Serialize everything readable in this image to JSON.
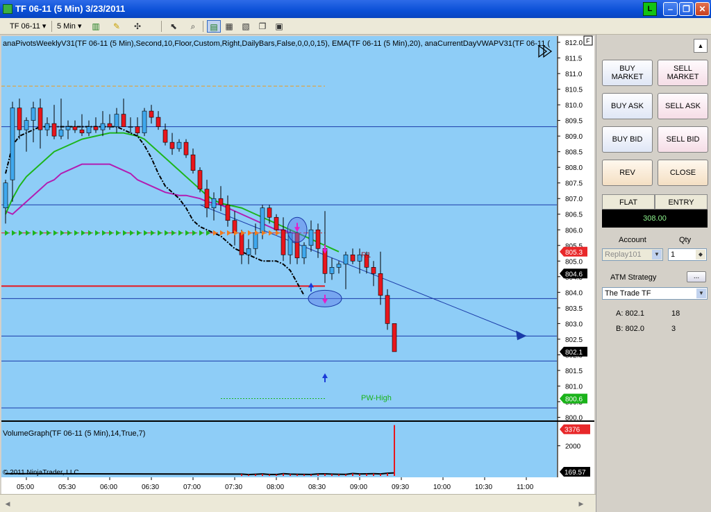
{
  "window": {
    "title": "TF 06-11 (5 Min)  3/23/2011",
    "status_letter": "L",
    "min_glyph": "‒",
    "restore_glyph": "❐",
    "close_glyph": "✕"
  },
  "toolbar": {
    "instrument": "TF 06-11",
    "interval": "5 Min",
    "dropdown_glyph": "▾"
  },
  "chart": {
    "indicator_label": "anaPivotsWeeklyV31(TF 06-11 (5 Min),Second,10,Floor,Custom,Right,DailyBars,False,0,0,0,15), EMA(TF 06-11 (5 Min),20), anaCurrentDayVWAPV31(TF 06-11 (",
    "f_button": "F",
    "annotations": {
      "r1": "R1",
      "pw_high": "PW-High"
    },
    "price_axis": [
      "812.0",
      "811.5",
      "811.0",
      "810.5",
      "810.0",
      "809.5",
      "809.0",
      "808.5",
      "808.0",
      "807.5",
      "807.0",
      "806.5",
      "806.0",
      "805.5",
      "805.0",
      "804.5",
      "804.0",
      "803.5",
      "803.0",
      "802.5",
      "802.0",
      "801.5",
      "801.0",
      "800.5",
      "800.0"
    ],
    "price_badges": [
      {
        "label": "805.3",
        "value": 805.3,
        "color": "#e8282a"
      },
      {
        "label": "804.6",
        "value": 804.6,
        "color": "#000000"
      },
      {
        "label": "802.1",
        "value": 802.1,
        "color": "#000000"
      },
      {
        "label": "800.6",
        "value": 800.6,
        "color": "#1ab31a"
      }
    ],
    "time_axis": [
      "05:00",
      "05:30",
      "06:00",
      "06:30",
      "07:00",
      "07:30",
      "08:00",
      "08:30",
      "09:00",
      "09:30",
      "10:00",
      "10:30",
      "11:00"
    ],
    "volume_label": "VolumeGraph(TF 06-11 (5 Min),14,True,7)",
    "volume_axis": [
      "2000"
    ],
    "volume_badges": [
      {
        "label": "3376",
        "value": 3376,
        "color": "#e8282a"
      },
      {
        "label": "169.57",
        "value": 169.57,
        "color": "#000000"
      }
    ],
    "copyright": "© 2011 NinjaTrader, LLC",
    "colors": {
      "background": "#8ecdf7",
      "up": "#3fa8ee",
      "down": "#e8161c",
      "ema": "#1db51d",
      "vwap": "#b21db2",
      "fast_ma": "#000000",
      "hlines": "#1a3aa8",
      "pivot_orange": "#f09b1c"
    }
  },
  "chart_data": {
    "type": "candlestick",
    "title": "TF 06-11 (5 Min)  3/23/2011",
    "y_range": [
      799.9,
      812.2
    ],
    "time_start": "04:45",
    "bar_minutes": 5,
    "candles": [
      {
        "o": 806.7,
        "h": 807.6,
        "l": 806.2,
        "c": 807.5
      },
      {
        "o": 807.6,
        "h": 810.1,
        "l": 806.9,
        "c": 809.9
      },
      {
        "o": 809.9,
        "h": 810.2,
        "l": 808.9,
        "c": 809.2
      },
      {
        "o": 809.2,
        "h": 809.6,
        "l": 808.5,
        "c": 809.5
      },
      {
        "o": 809.5,
        "h": 810.1,
        "l": 808.8,
        "c": 809.9
      },
      {
        "o": 809.9,
        "h": 810.2,
        "l": 808.6,
        "c": 809.2
      },
      {
        "o": 809.2,
        "h": 809.6,
        "l": 809.0,
        "c": 809.4
      },
      {
        "o": 809.4,
        "h": 810.0,
        "l": 808.9,
        "c": 809.0
      },
      {
        "o": 809.0,
        "h": 810.2,
        "l": 808.9,
        "c": 809.2
      },
      {
        "o": 809.2,
        "h": 809.5,
        "l": 808.9,
        "c": 809.3
      },
      {
        "o": 809.3,
        "h": 809.5,
        "l": 809.1,
        "c": 809.2
      },
      {
        "o": 809.2,
        "h": 809.7,
        "l": 809.0,
        "c": 809.1
      },
      {
        "o": 809.1,
        "h": 809.5,
        "l": 809.0,
        "c": 809.3
      },
      {
        "o": 809.3,
        "h": 809.6,
        "l": 809.1,
        "c": 809.2
      },
      {
        "o": 809.2,
        "h": 809.8,
        "l": 809.0,
        "c": 809.4
      },
      {
        "o": 809.4,
        "h": 809.7,
        "l": 809.2,
        "c": 809.3
      },
      {
        "o": 809.3,
        "h": 809.9,
        "l": 809.1,
        "c": 809.7
      },
      {
        "o": 809.7,
        "h": 810.2,
        "l": 809.3,
        "c": 809.3
      },
      {
        "o": 809.3,
        "h": 809.6,
        "l": 809.1,
        "c": 809.3
      },
      {
        "o": 809.3,
        "h": 809.6,
        "l": 809.0,
        "c": 809.1
      },
      {
        "o": 809.1,
        "h": 809.9,
        "l": 809.0,
        "c": 809.8
      },
      {
        "o": 809.8,
        "h": 810.0,
        "l": 809.4,
        "c": 809.6
      },
      {
        "o": 809.6,
        "h": 809.8,
        "l": 809.2,
        "c": 809.3
      },
      {
        "o": 809.2,
        "h": 809.4,
        "l": 808.7,
        "c": 808.8
      },
      {
        "o": 808.8,
        "h": 809.1,
        "l": 808.4,
        "c": 808.6
      },
      {
        "o": 808.6,
        "h": 808.9,
        "l": 808.5,
        "c": 808.8
      },
      {
        "o": 808.8,
        "h": 808.9,
        "l": 808.3,
        "c": 808.4
      },
      {
        "o": 808.4,
        "h": 808.6,
        "l": 807.8,
        "c": 807.9
      },
      {
        "o": 807.9,
        "h": 808.0,
        "l": 807.2,
        "c": 807.3
      },
      {
        "o": 807.3,
        "h": 807.6,
        "l": 806.4,
        "c": 806.7
      },
      {
        "o": 806.7,
        "h": 807.2,
        "l": 806.3,
        "c": 807.0
      },
      {
        "o": 807.0,
        "h": 807.4,
        "l": 806.6,
        "c": 806.8
      },
      {
        "o": 806.8,
        "h": 807.1,
        "l": 806.1,
        "c": 806.3
      },
      {
        "o": 806.3,
        "h": 806.6,
        "l": 805.5,
        "c": 805.9
      },
      {
        "o": 805.9,
        "h": 806.0,
        "l": 804.9,
        "c": 805.2
      },
      {
        "o": 805.2,
        "h": 805.7,
        "l": 804.9,
        "c": 805.4
      },
      {
        "o": 805.4,
        "h": 806.2,
        "l": 805.2,
        "c": 805.9
      },
      {
        "o": 805.9,
        "h": 806.8,
        "l": 805.7,
        "c": 806.7
      },
      {
        "o": 806.7,
        "h": 806.8,
        "l": 806.2,
        "c": 806.4
      },
      {
        "o": 806.4,
        "h": 806.5,
        "l": 805.9,
        "c": 806.0
      },
      {
        "o": 806.0,
        "h": 806.4,
        "l": 805.0,
        "c": 805.2
      },
      {
        "o": 805.2,
        "h": 806.0,
        "l": 804.9,
        "c": 805.9
      },
      {
        "o": 805.9,
        "h": 806.2,
        "l": 804.9,
        "c": 805.1
      },
      {
        "o": 805.1,
        "h": 805.6,
        "l": 804.9,
        "c": 805.5
      },
      {
        "o": 805.5,
        "h": 806.3,
        "l": 805.3,
        "c": 806.0
      },
      {
        "o": 806.0,
        "h": 806.2,
        "l": 805.1,
        "c": 805.4
      },
      {
        "o": 805.4,
        "h": 806.6,
        "l": 804.3,
        "c": 804.6
      },
      {
        "o": 804.6,
        "h": 805.1,
        "l": 804.4,
        "c": 804.8
      },
      {
        "o": 804.8,
        "h": 805.0,
        "l": 804.6,
        "c": 804.9
      },
      {
        "o": 804.9,
        "h": 805.3,
        "l": 804.1,
        "c": 805.2
      },
      {
        "o": 805.2,
        "h": 805.4,
        "l": 804.9,
        "c": 805.0
      },
      {
        "o": 805.0,
        "h": 805.4,
        "l": 804.6,
        "c": 805.2
      },
      {
        "o": 805.2,
        "h": 805.3,
        "l": 804.6,
        "c": 804.8
      },
      {
        "o": 804.8,
        "h": 805.0,
        "l": 804.2,
        "c": 804.6
      },
      {
        "o": 804.6,
        "h": 805.3,
        "l": 803.6,
        "c": 803.9
      },
      {
        "o": 803.9,
        "h": 804.1,
        "l": 802.8,
        "c": 803.0
      },
      {
        "o": 803.0,
        "h": 803.0,
        "l": 802.1,
        "c": 802.1
      }
    ],
    "volume": [
      120,
      90,
      110,
      130,
      100,
      95,
      150,
      120,
      110,
      105,
      100,
      130,
      140,
      120,
      110,
      105,
      160,
      130,
      140,
      150,
      135,
      180,
      3376
    ],
    "volume_range": [
      0,
      3500
    ],
    "horizontal_levels": [
      {
        "value": 810.6,
        "color": "#f09b1c",
        "style": "dashed",
        "x_end_time": "08:35"
      },
      {
        "value": 809.3,
        "color": "#1a3aa8",
        "style": "solid"
      },
      {
        "value": 806.8,
        "color": "#1a3aa8",
        "style": "solid"
      },
      {
        "value": 805.9,
        "color": "#e8161c",
        "style": "dashdot",
        "x_end_time": "08:35"
      },
      {
        "value": 804.2,
        "color": "#e8161c",
        "style": "solid",
        "x_end_time": "08:35"
      },
      {
        "value": 803.8,
        "color": "#1a3aa8",
        "style": "solid"
      },
      {
        "value": 802.6,
        "color": "#1a3aa8",
        "style": "solid"
      },
      {
        "value": 801.8,
        "color": "#1a3aa8",
        "style": "solid"
      },
      {
        "value": 800.6,
        "color": "#1ab31a",
        "style": "dotted",
        "x_start_time": "07:20",
        "x_end_time": "08:35"
      },
      {
        "value": 800.3,
        "color": "#1a3aa8",
        "style": "solid"
      }
    ],
    "trendline": {
      "from": {
        "time": "07:05",
        "price": 806.8
      },
      "to": {
        "time": "11:00",
        "price": 802.6
      },
      "color": "#1a3aa8"
    },
    "ema": [
      806.5,
      807.0,
      807.4,
      807.7,
      807.9,
      808.1,
      808.3,
      808.5,
      808.6,
      808.7,
      808.8,
      808.9,
      808.95,
      809.0,
      809.05,
      809.1,
      809.1,
      809.1,
      809.05,
      809.0,
      808.9,
      808.7,
      808.5,
      808.3,
      808.1,
      807.9,
      807.7,
      807.5,
      807.3,
      807.1,
      806.95,
      806.85,
      806.8,
      806.75,
      806.7,
      806.6,
      806.5,
      806.4,
      806.3,
      806.2,
      806.1,
      806.0,
      805.9,
      805.8,
      805.7,
      805.6,
      805.5,
      805.4,
      805.3
    ],
    "vwap": [
      806.6,
      806.5,
      806.7,
      806.9,
      807.1,
      807.3,
      807.5,
      807.6,
      807.8,
      807.9,
      808.0,
      808.1,
      808.1,
      808.1,
      808.1,
      808.1,
      808.0,
      807.9,
      807.8,
      807.6,
      807.5,
      807.4,
      807.3,
      807.2,
      807.15,
      807.1,
      807.1,
      807.05,
      807.0,
      806.9,
      806.85,
      806.8,
      806.7,
      806.6,
      806.5,
      806.4,
      806.3,
      806.2,
      806.1,
      806.0,
      806.0,
      805.9,
      805.9
    ],
    "fast_ma": [
      807.8,
      808.7,
      809.0,
      809.1,
      809.2,
      809.3,
      809.3,
      809.3,
      809.3,
      809.3,
      809.3,
      809.3,
      809.3,
      809.3,
      809.3,
      809.3,
      809.3,
      809.2,
      809.1,
      809.0,
      808.7,
      808.3,
      807.8,
      807.4,
      807.2,
      807.0,
      806.7,
      806.3,
      806.1,
      806.0,
      805.9,
      805.8,
      805.6,
      805.4,
      805.3,
      805.2,
      805.1,
      805.0,
      805.0,
      805.0,
      804.9,
      804.7,
      804.3,
      803.9
    ]
  },
  "orders": {
    "buy_market": "BUY\nMARKET",
    "sell_market": "SELL\nMARKET",
    "buy_ask": "BUY ASK",
    "sell_ask": "SELL ASK",
    "buy_bid": "BUY BID",
    "sell_bid": "SELL BID",
    "rev": "REV",
    "close": "CLOSE",
    "position_label": "FLAT",
    "entry_label": "ENTRY",
    "position_value": "308.00",
    "account_label": "Account",
    "qty_label": "Qty",
    "account_value": "Replay101",
    "qty_value": "1",
    "atm_label": "ATM Strategy",
    "atm_button": "...",
    "atm_value": "The Trade TF",
    "ask_label": "A: 802.1",
    "ask_qty": "18",
    "bid_label": "B: 802.0",
    "bid_qty": "3",
    "collapse_glyph": "▲"
  }
}
